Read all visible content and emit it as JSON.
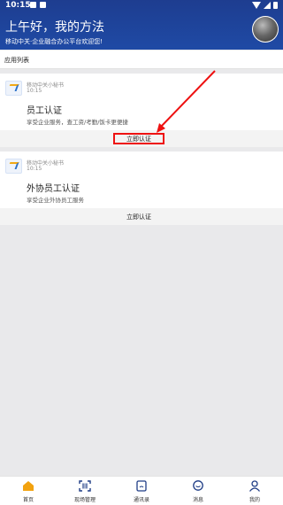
{
  "status_bar": {
    "time": "10:15"
  },
  "header": {
    "greeting": "上午好，我的方法",
    "welcome": "移动中关·企业融合办公平台欢迎您!"
  },
  "section": {
    "label": "应用列表"
  },
  "cards": [
    {
      "source": "移动中关小秘书",
      "time": "10:15",
      "title": "员工认证",
      "description": "享受企业服务，查工资/考勤/饭卡更便捷",
      "action": "立即认证"
    },
    {
      "source": "移动中关小秘书",
      "time": "10:15",
      "title": "外协员工认证",
      "description": "享受企业外协员工服务",
      "action": "立即认证"
    }
  ],
  "tabbar": {
    "items": [
      {
        "label": "首页",
        "icon": "home-icon",
        "active": true
      },
      {
        "label": "现场管理",
        "icon": "scan-icon"
      },
      {
        "label": "通讯录",
        "icon": "contacts-icon"
      },
      {
        "label": "消息",
        "icon": "message-icon"
      },
      {
        "label": "我的",
        "icon": "user-icon"
      }
    ]
  },
  "colors": {
    "header_bg": "#1f4aa5",
    "highlight": "#ee1111",
    "tab_active": "#f2a20f",
    "tab_inactive": "#1f3d86"
  }
}
